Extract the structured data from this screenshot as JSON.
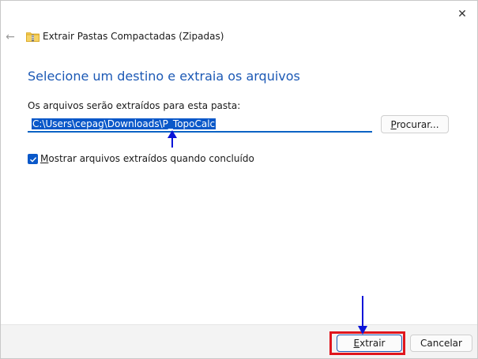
{
  "window": {
    "title": "Extrair Pastas Compactadas (Zipadas)",
    "close_glyph": "✕",
    "back_glyph": "←"
  },
  "main": {
    "heading": "Selecione um destino e extraia os arquivos",
    "dest_label": "Os arquivos serão extraídos para esta pasta:",
    "path_value": "C:\\Users\\cepag\\Downloads\\P_TopoCalc",
    "browse_label_mnemonic": "P",
    "browse_label_rest": "rocurar...",
    "checkbox_checked": true,
    "checkbox_label_before": "M",
    "checkbox_label_after": "ostrar arquivos extraídos quando concluído"
  },
  "footer": {
    "extract_mnemonic": "E",
    "extract_rest": "xtrair",
    "cancel_label": "Cancelar"
  },
  "colors": {
    "accent": "#0a58c9",
    "heading": "#1c59b5",
    "annotation_arrow": "#0a14d8",
    "highlight": "#e0161d"
  },
  "icons": {
    "title_icon": "zip-folder-icon",
    "back": "back-arrow-icon",
    "close": "close-icon"
  }
}
